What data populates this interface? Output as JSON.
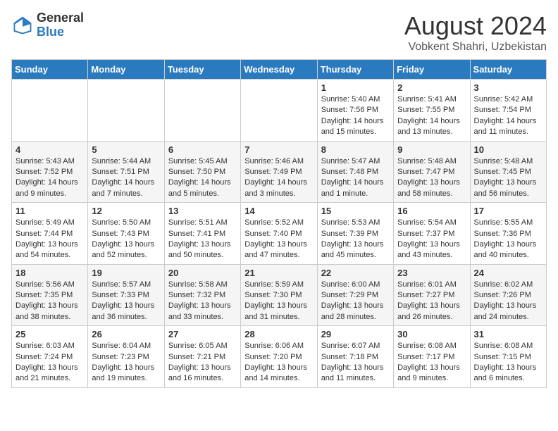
{
  "logo": {
    "general": "General",
    "blue": "Blue"
  },
  "header": {
    "month": "August 2024",
    "location": "Vobkent Shahri, Uzbekistan"
  },
  "days_of_week": [
    "Sunday",
    "Monday",
    "Tuesday",
    "Wednesday",
    "Thursday",
    "Friday",
    "Saturday"
  ],
  "weeks": [
    [
      {
        "day": "",
        "info": ""
      },
      {
        "day": "",
        "info": ""
      },
      {
        "day": "",
        "info": ""
      },
      {
        "day": "",
        "info": ""
      },
      {
        "day": "1",
        "info": "Sunrise: 5:40 AM\nSunset: 7:56 PM\nDaylight: 14 hours and 15 minutes."
      },
      {
        "day": "2",
        "info": "Sunrise: 5:41 AM\nSunset: 7:55 PM\nDaylight: 14 hours and 13 minutes."
      },
      {
        "day": "3",
        "info": "Sunrise: 5:42 AM\nSunset: 7:54 PM\nDaylight: 14 hours and 11 minutes."
      }
    ],
    [
      {
        "day": "4",
        "info": "Sunrise: 5:43 AM\nSunset: 7:52 PM\nDaylight: 14 hours and 9 minutes."
      },
      {
        "day": "5",
        "info": "Sunrise: 5:44 AM\nSunset: 7:51 PM\nDaylight: 14 hours and 7 minutes."
      },
      {
        "day": "6",
        "info": "Sunrise: 5:45 AM\nSunset: 7:50 PM\nDaylight: 14 hours and 5 minutes."
      },
      {
        "day": "7",
        "info": "Sunrise: 5:46 AM\nSunset: 7:49 PM\nDaylight: 14 hours and 3 minutes."
      },
      {
        "day": "8",
        "info": "Sunrise: 5:47 AM\nSunset: 7:48 PM\nDaylight: 14 hours and 1 minute."
      },
      {
        "day": "9",
        "info": "Sunrise: 5:48 AM\nSunset: 7:47 PM\nDaylight: 13 hours and 58 minutes."
      },
      {
        "day": "10",
        "info": "Sunrise: 5:48 AM\nSunset: 7:45 PM\nDaylight: 13 hours and 56 minutes."
      }
    ],
    [
      {
        "day": "11",
        "info": "Sunrise: 5:49 AM\nSunset: 7:44 PM\nDaylight: 13 hours and 54 minutes."
      },
      {
        "day": "12",
        "info": "Sunrise: 5:50 AM\nSunset: 7:43 PM\nDaylight: 13 hours and 52 minutes."
      },
      {
        "day": "13",
        "info": "Sunrise: 5:51 AM\nSunset: 7:41 PM\nDaylight: 13 hours and 50 minutes."
      },
      {
        "day": "14",
        "info": "Sunrise: 5:52 AM\nSunset: 7:40 PM\nDaylight: 13 hours and 47 minutes."
      },
      {
        "day": "15",
        "info": "Sunrise: 5:53 AM\nSunset: 7:39 PM\nDaylight: 13 hours and 45 minutes."
      },
      {
        "day": "16",
        "info": "Sunrise: 5:54 AM\nSunset: 7:37 PM\nDaylight: 13 hours and 43 minutes."
      },
      {
        "day": "17",
        "info": "Sunrise: 5:55 AM\nSunset: 7:36 PM\nDaylight: 13 hours and 40 minutes."
      }
    ],
    [
      {
        "day": "18",
        "info": "Sunrise: 5:56 AM\nSunset: 7:35 PM\nDaylight: 13 hours and 38 minutes."
      },
      {
        "day": "19",
        "info": "Sunrise: 5:57 AM\nSunset: 7:33 PM\nDaylight: 13 hours and 36 minutes."
      },
      {
        "day": "20",
        "info": "Sunrise: 5:58 AM\nSunset: 7:32 PM\nDaylight: 13 hours and 33 minutes."
      },
      {
        "day": "21",
        "info": "Sunrise: 5:59 AM\nSunset: 7:30 PM\nDaylight: 13 hours and 31 minutes."
      },
      {
        "day": "22",
        "info": "Sunrise: 6:00 AM\nSunset: 7:29 PM\nDaylight: 13 hours and 28 minutes."
      },
      {
        "day": "23",
        "info": "Sunrise: 6:01 AM\nSunset: 7:27 PM\nDaylight: 13 hours and 26 minutes."
      },
      {
        "day": "24",
        "info": "Sunrise: 6:02 AM\nSunset: 7:26 PM\nDaylight: 13 hours and 24 minutes."
      }
    ],
    [
      {
        "day": "25",
        "info": "Sunrise: 6:03 AM\nSunset: 7:24 PM\nDaylight: 13 hours and 21 minutes."
      },
      {
        "day": "26",
        "info": "Sunrise: 6:04 AM\nSunset: 7:23 PM\nDaylight: 13 hours and 19 minutes."
      },
      {
        "day": "27",
        "info": "Sunrise: 6:05 AM\nSunset: 7:21 PM\nDaylight: 13 hours and 16 minutes."
      },
      {
        "day": "28",
        "info": "Sunrise: 6:06 AM\nSunset: 7:20 PM\nDaylight: 13 hours and 14 minutes."
      },
      {
        "day": "29",
        "info": "Sunrise: 6:07 AM\nSunset: 7:18 PM\nDaylight: 13 hours and 11 minutes."
      },
      {
        "day": "30",
        "info": "Sunrise: 6:08 AM\nSunset: 7:17 PM\nDaylight: 13 hours and 9 minutes."
      },
      {
        "day": "31",
        "info": "Sunrise: 6:08 AM\nSunset: 7:15 PM\nDaylight: 13 hours and 6 minutes."
      }
    ]
  ]
}
